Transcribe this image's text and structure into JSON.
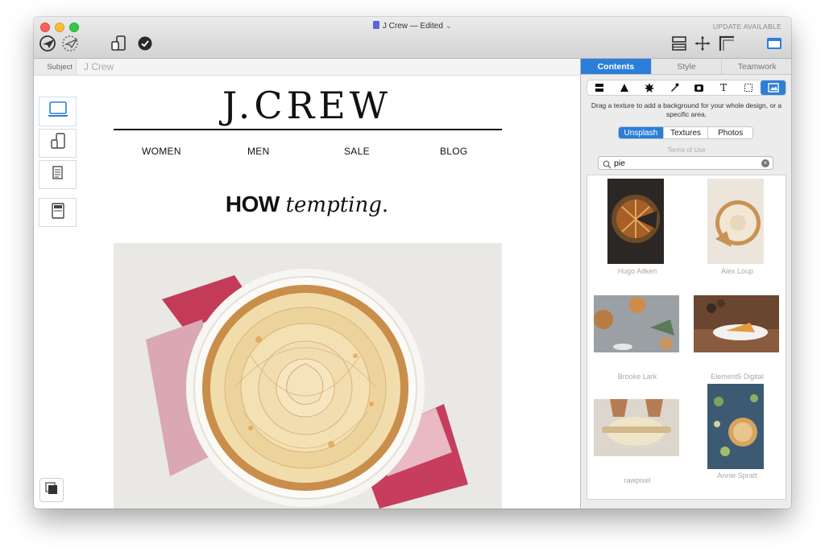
{
  "window": {
    "title": "J Crew — Edited",
    "title_chevron": "⌄",
    "update_label": "UPDATE AVAILABLE"
  },
  "toolbar": {
    "left_icons": [
      "send-test-icon",
      "schedule-send-icon",
      "device-preview-icon",
      "checkmark-icon"
    ],
    "right_icons": [
      "layout-grid-icon",
      "move-crosshair-icon",
      "margin-ruler-icon",
      "sidebar-toggle-icon"
    ]
  },
  "subject": {
    "label": "Subject",
    "value": "J Crew"
  },
  "device_buttons": [
    "laptop-icon",
    "mobile-tablet-icon",
    "text-document-icon",
    "inbox-preview-icon"
  ],
  "email": {
    "logo": "J.CREW",
    "nav": [
      "WOMEN",
      "MEN",
      "SALE",
      "BLOG"
    ],
    "headline_bold": "HOW",
    "headline_italic": "tempting."
  },
  "inspector": {
    "tabs": [
      "Contents",
      "Style",
      "Teamwork"
    ],
    "active_tab": 0,
    "tool_icons": [
      "block-icon",
      "triangle-icon",
      "burst-icon",
      "dropper-icon",
      "camera-icon",
      "text-icon",
      "selection-icon",
      "image-icon"
    ],
    "tool_labels": [
      "",
      "",
      "",
      "",
      "",
      "T",
      "",
      ""
    ],
    "active_tool": 7,
    "hint": "Drag a texture to add a background for your whole design, or a specific area.",
    "sources": [
      "Unsplash",
      "Textures",
      "Photos"
    ],
    "active_source": 0,
    "terms": "Terms of Use",
    "search_value": "pie",
    "results": [
      {
        "author": "Hugo Aitken"
      },
      {
        "author": "Alex Loup"
      },
      {
        "author": "Brooke Lark"
      },
      {
        "author": "Element5 Digital"
      },
      {
        "author": "rawpixel"
      },
      {
        "author": "Annie Spratt"
      }
    ]
  },
  "colors": {
    "accent": "#2c7fd8",
    "close": "#fc605c",
    "minimize": "#fdbc40",
    "maximize": "#34c84a"
  }
}
